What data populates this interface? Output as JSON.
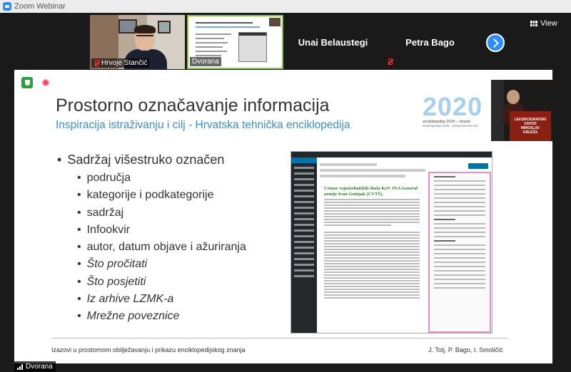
{
  "window": {
    "title": "Zoom Webinar"
  },
  "participants": [
    {
      "name": "Hrvoje Stančić",
      "muted": true
    },
    {
      "name": "Dvorana",
      "muted": false
    },
    {
      "name": "Unai Belaustegi",
      "muted": false
    },
    {
      "name": "Petra Bago",
      "muted": true
    }
  ],
  "view_button": {
    "label": "View"
  },
  "shared_label": "Dvorana",
  "slide": {
    "title": "Prostorno označavanje informacija",
    "subtitle": "Inspiracija istraživanju i cilj - Hrvatska tehnička enciklopedija",
    "logo": {
      "number": "2020",
      "caption": "enciklopedija 2020 – dosad",
      "caption2": "enciklopedija 2020 - achievements and"
    },
    "podium_text": [
      "LEKSIKOGRAFSKI",
      "ZAVOD",
      "MIROSLAV",
      "KRLEŽA"
    ],
    "main_bullet": "Sadržaj višestruko označen",
    "sub_bullets": [
      {
        "text": "područja",
        "italic": false
      },
      {
        "text": "kategorije i podkategorije",
        "italic": false
      },
      {
        "text": "sadržaj",
        "italic": false
      },
      {
        "text": "Infookvir",
        "italic": false
      },
      {
        "text": "autor, datum objave i ažuriranja",
        "italic": false
      },
      {
        "text": "Što pročitati",
        "italic": true
      },
      {
        "text": "Što posjetiti",
        "italic": true
      },
      {
        "text": "Iz arhive LZMK-a",
        "italic": true
      },
      {
        "text": "Mrežne poveznice",
        "italic": true
      }
    ],
    "screenshot_heading": "Centar vojnotehničkih škola KoV JNA General armije Ivan Gošnjak (CVTŠ),",
    "footer_left": "Izazovi u prostornom obilježavanju i prikazu enciklopedijskog znanja",
    "footer_right": "J. Tolj, P. Bago, I. Smoličić"
  },
  "colors": {
    "zoom_blue": "#2d8cff",
    "subtitle_blue": "#3a8fc8",
    "highlight_pink": "#e78fc2",
    "speaker_border": "#8bc34a"
  }
}
